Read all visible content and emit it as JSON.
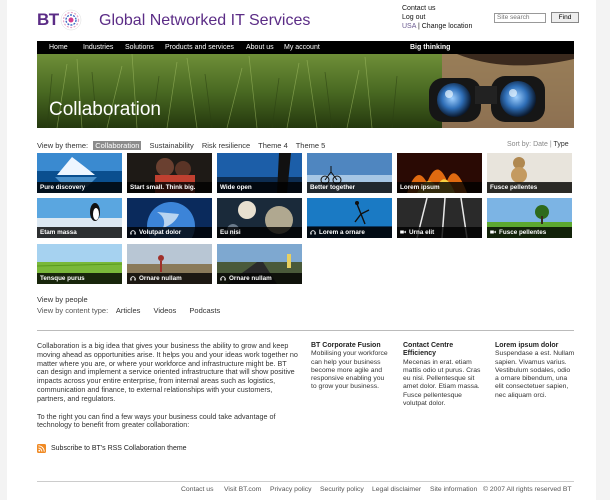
{
  "brand": {
    "logo_text": "BT",
    "site_title": "Global Networked IT Services"
  },
  "top_links": {
    "contact": "Contact us",
    "logout": "Log out",
    "region": "USA",
    "separator": "|",
    "change_location": "Change location"
  },
  "search": {
    "placeholder": "Site search",
    "button": "Find"
  },
  "nav": {
    "items": [
      "Home",
      "Industries",
      "Solutions",
      "Products and services",
      "About us",
      "My account"
    ],
    "big_thinking": "Big thinking"
  },
  "hero": {
    "title": "Collaboration"
  },
  "themes": {
    "label": "View by theme:",
    "items": [
      "Collaboration",
      "Sustainability",
      "Risk resilience",
      "Theme 4",
      "Theme 5"
    ],
    "active": "Collaboration",
    "sort_label": "Sort by: Date",
    "sort_sep": "|",
    "sort_type": "Type"
  },
  "tiles": [
    {
      "label": "Pure discovery",
      "icon": ""
    },
    {
      "label": "Start small. Think big.",
      "icon": ""
    },
    {
      "label": "Wide open",
      "icon": ""
    },
    {
      "label": "Better together",
      "icon": ""
    },
    {
      "label": "Lorem ipsum",
      "icon": ""
    },
    {
      "label": "Fusce pellentes",
      "icon": ""
    },
    {
      "label": "Etam massa",
      "icon": ""
    },
    {
      "label": "Volutpat dolor",
      "icon": "headphones-icon"
    },
    {
      "label": "Eu nisi",
      "icon": ""
    },
    {
      "label": "Lorem a ornare",
      "icon": "headphones-icon"
    },
    {
      "label": "Urna elit",
      "icon": "video-camera-icon"
    },
    {
      "label": "Fusce pellentes",
      "icon": "video-camera-icon"
    },
    {
      "label": "Tensque purus",
      "icon": ""
    },
    {
      "label": "Ornare nullam",
      "icon": "headphones-icon"
    },
    {
      "label": "Ornare nullam",
      "icon": "headphones-icon"
    }
  ],
  "view_people": "View by people",
  "content_type": {
    "label": "View by content type:",
    "items": [
      "Articles",
      "Videos",
      "Podcasts"
    ]
  },
  "intro": {
    "p1": "Collaboration is a big idea that gives your business the ability to grow and keep moving ahead as opportunities arise. It helps you and your ideas work together no matter where you are, or where your workforce and infrastructure might be. BT can design and implement a service oriented infrastructure that will show positive impacts across your entire enterprise, from internal areas such as logistics, communication and finance, to external relationships with your customers, partners, and regulators.",
    "p2": "To the right you can find a few ways your business could take advantage of technology to benefit from greater collaboration:"
  },
  "columns": [
    {
      "title": "BT Corporate Fusion",
      "text": "Mobilising your workforce can help your business become more agile and responsive enabling you to grow your business."
    },
    {
      "title": "Contact Centre Efficiency",
      "text": "Mecenas in erat. etiam mattis odio ut purus. Cras eu nisi. Pellentesque sit amet dolor. Etiam massa. Fusce pellentesque volutpat dolor."
    },
    {
      "title": "Lorem ipsum dolor",
      "text": "Suspendase a est. Nullam sapien. Vivamus varius. Vestibulum sodales, odio a ornare bibendum, una elit consectetuer sapien, nec aliquam orci."
    }
  ],
  "rss": "Subscribe to BT's RSS Collaboration theme",
  "footer": [
    "Contact us",
    "Visit BT.com",
    "Privacy policy",
    "Security policy",
    "Legal disclaimer",
    "Site information",
    "© 2007 All rights reserved BT"
  ],
  "colors": {
    "brand_purple": "#5b2c86",
    "nav_bg": "#000000",
    "active_theme": "#8c8c8c"
  }
}
